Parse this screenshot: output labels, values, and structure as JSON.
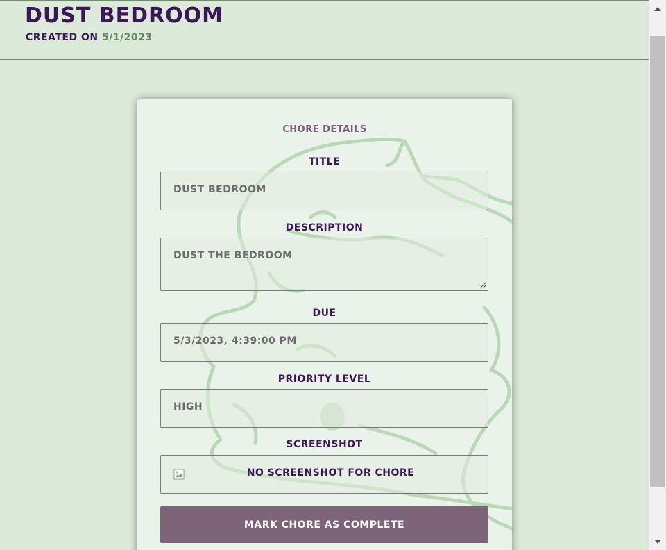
{
  "header": {
    "title": "Dust Bedroom",
    "created_prefix": "Created on",
    "created_date": "5/1/2023"
  },
  "card": {
    "heading": "Chore Details",
    "fields": [
      {
        "label": "Title",
        "value": "Dust Bedroom"
      },
      {
        "label": "Description",
        "value": "Dust the bedroom"
      },
      {
        "label": "Due",
        "value": "5/3/2023, 4:39:00 PM"
      },
      {
        "label": "Priority Level",
        "value": "High"
      },
      {
        "label": "Screenshot",
        "value": "No Screenshot for Chore"
      }
    ],
    "complete_button": "Mark Chore as Complete"
  },
  "icons": {
    "broken_image": "broken-image-icon",
    "scroll_up": "arrow-up-icon",
    "scroll_down": "arrow-down-icon",
    "watermark": "dragon-watermark"
  },
  "colors": {
    "background": "#dcead9",
    "title": "#3c1758",
    "date": "#5e8a5b",
    "button": "#7e6479"
  }
}
